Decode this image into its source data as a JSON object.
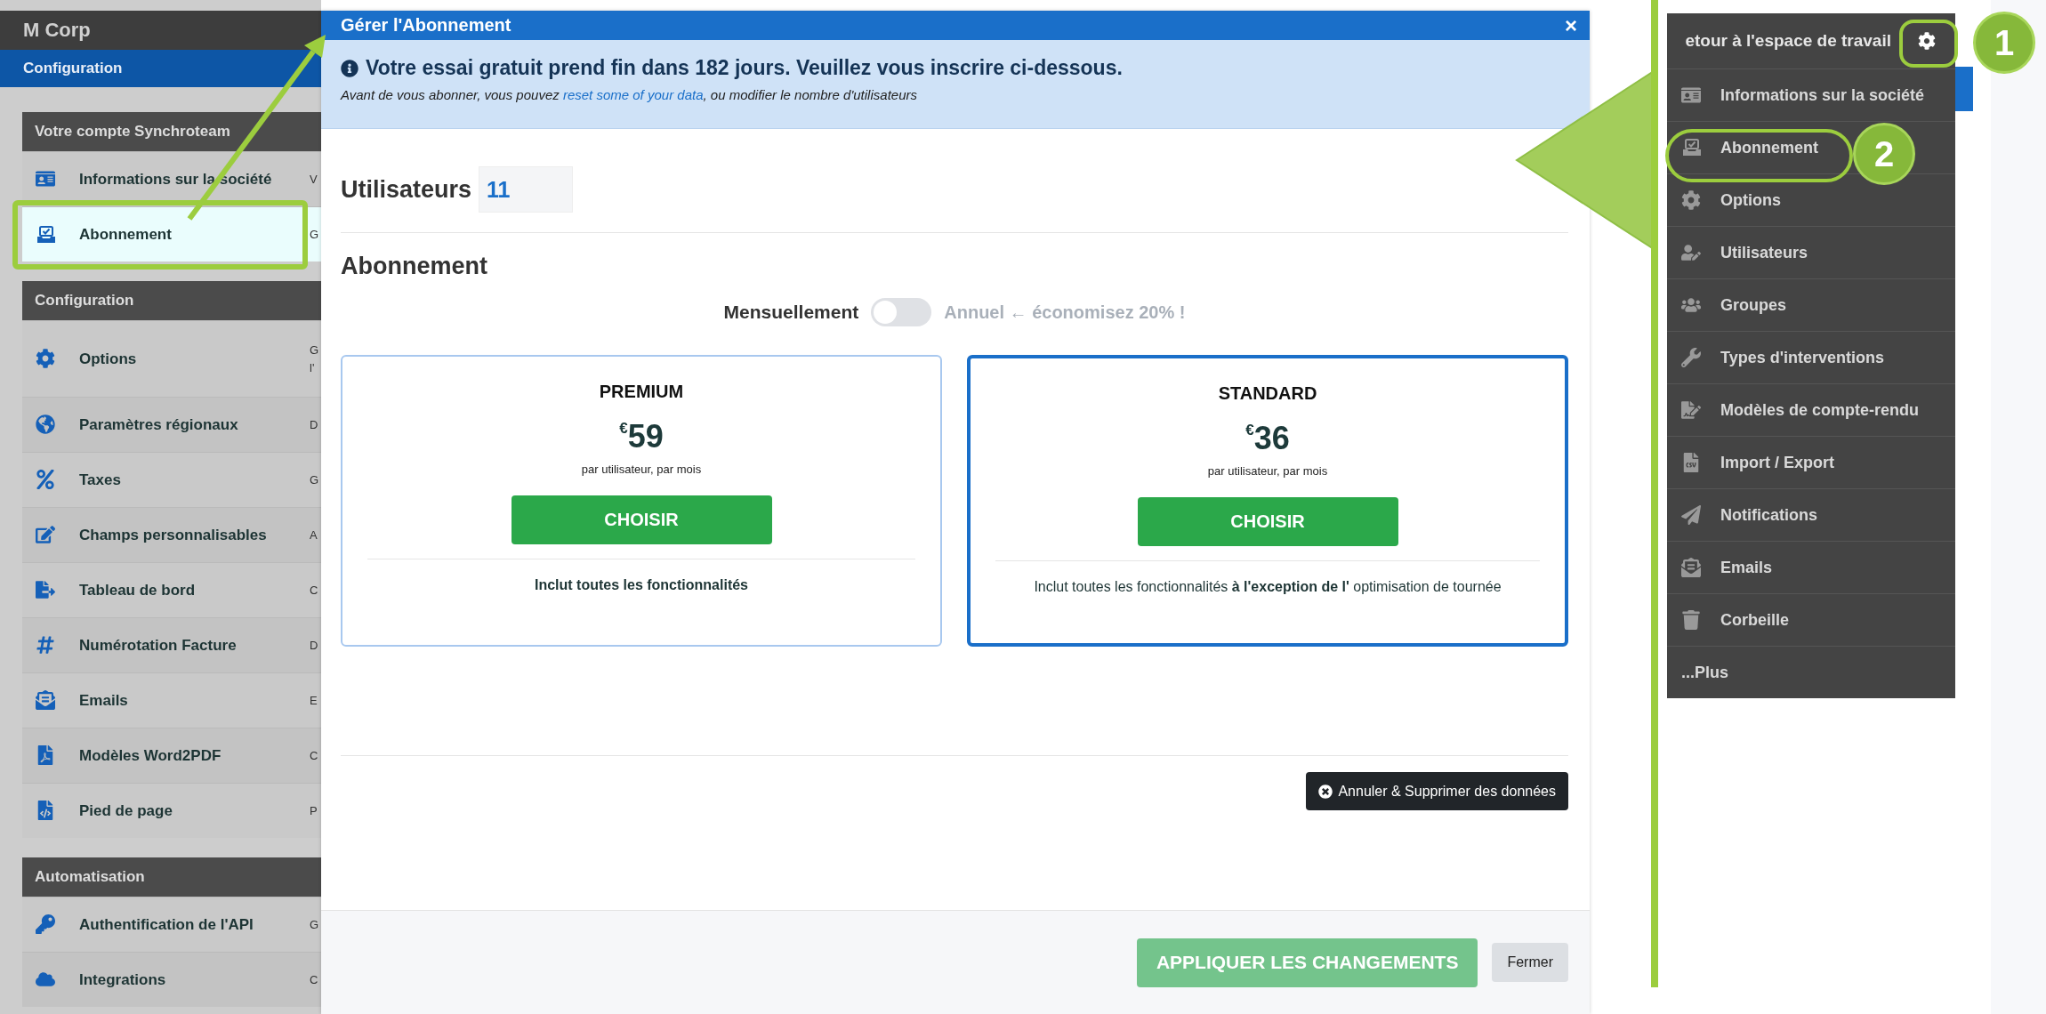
{
  "app": {
    "company": "M Corp",
    "section_bar": "Configuration"
  },
  "sidebar": {
    "groups": [
      {
        "title": "Votre compte Synchroteam",
        "items": [
          {
            "label": "Informations sur la société",
            "description": "V",
            "selected": false
          },
          {
            "label": "Abonnement",
            "description": "G",
            "selected": true
          }
        ]
      },
      {
        "title": "Configuration",
        "items": [
          {
            "label": "Options",
            "description": "G l'",
            "selected": false
          },
          {
            "label": "Paramètres régionaux",
            "description": "D",
            "selected": false
          },
          {
            "label": "Taxes",
            "description": "G",
            "selected": false
          },
          {
            "label": "Champs personnalisables",
            "description": "A",
            "selected": false
          },
          {
            "label": "Tableau de bord",
            "description": "C",
            "selected": false
          },
          {
            "label": "Numérotation Facture",
            "description": "D",
            "selected": false
          },
          {
            "label": "Emails",
            "description": "E",
            "selected": false
          },
          {
            "label": "Modèles Word2PDF",
            "description": "C",
            "selected": false
          },
          {
            "label": "Pied de page",
            "description": "P",
            "selected": false
          }
        ]
      },
      {
        "title": "Automatisation",
        "items": [
          {
            "label": "Authentification de l'API",
            "description": "G",
            "selected": false
          },
          {
            "label": "Integrations",
            "description": "C",
            "selected": false
          }
        ]
      }
    ]
  },
  "modal": {
    "title": "Gérer l'Abonnement",
    "close": "×",
    "alert": {
      "headline": "Votre essai gratuit prend fin dans 182 jours. Veuillez vous inscrire ci-dessous.",
      "text_before": "Avant de vous abonner, vous pouvez ",
      "link": "reset some of your data",
      "text_after": ", ou modifier le nombre d'utilisateurs"
    },
    "users": {
      "label": "Utilisateurs",
      "value": "11"
    },
    "subscription_heading": "Abonnement",
    "billing": {
      "monthly_label": "Mensuellement",
      "annual": false,
      "annual_label": "Annuel ← économisez 20% !"
    },
    "plans": [
      {
        "name": "PREMIUM",
        "price": "$^{€}$59",
        "unit": "par utilisateur, par mois",
        "button": "CHOISIR",
        "feature": "Inclut toutes les fonctionnalités",
        "feature_bold": true,
        "selected": false
      },
      {
        "name": "STANDARD",
        "price": "$^{€}$36",
        "unit": "par utilisateur, par mois",
        "button": "CHOISIR",
        "feature": "Inclut toutes les fonctionnalités **à l'exception de l'** optimisation de tournée",
        "feature_bold": false,
        "selected": true
      }
    ],
    "cancel_button": "Annuler & Supprimer des données",
    "apply_button": {
      "label": "APPLIQUER LES CHANGEMENTS",
      "disabled": true
    },
    "close_button": "Fermer"
  },
  "settings_menu": {
    "back_link": "etour à l'espace de travail",
    "items": [
      {
        "label": "Informations sur la société"
      },
      {
        "label": "Abonnement"
      },
      {
        "label": "Options"
      },
      {
        "label": "Utilisateurs"
      },
      {
        "label": "Groupes"
      },
      {
        "label": "Types d'interventions"
      },
      {
        "label": "Modèles de compte-rendu"
      },
      {
        "label": "Import / Export"
      },
      {
        "label": "Notifications"
      },
      {
        "label": "Emails"
      },
      {
        "label": "Corbeille"
      },
      {
        "label": "...Plus"
      }
    ]
  },
  "callouts": [
    "1",
    "2"
  ]
}
